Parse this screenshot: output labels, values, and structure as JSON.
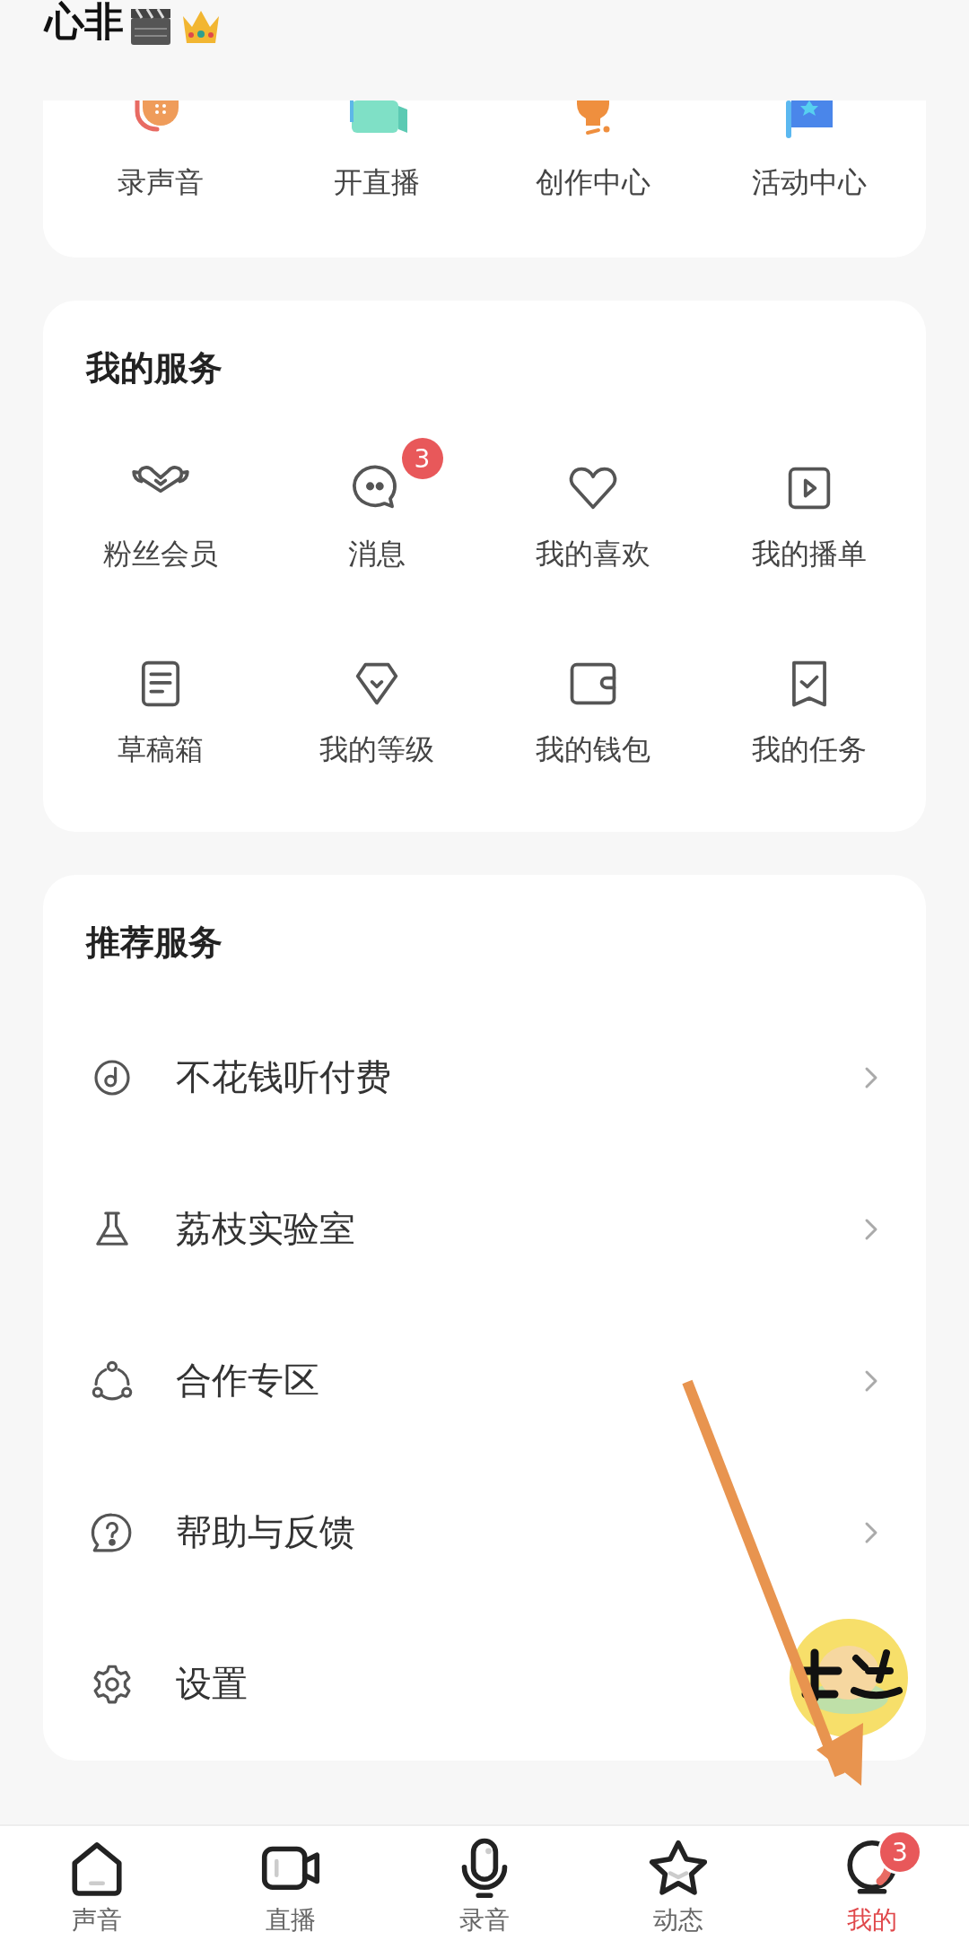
{
  "header": {
    "title": "心非"
  },
  "shortcuts": [
    {
      "label": "录声音",
      "kind": "mic"
    },
    {
      "label": "开直播",
      "kind": "live"
    },
    {
      "label": "创作中心",
      "kind": "bulb"
    },
    {
      "label": "活动中心",
      "kind": "flag"
    }
  ],
  "my_services": {
    "title": "我的服务",
    "items": [
      {
        "label": "粉丝会员",
        "kind": "wings"
      },
      {
        "label": "消息",
        "kind": "chat",
        "badge": "3"
      },
      {
        "label": "我的喜欢",
        "kind": "heart"
      },
      {
        "label": "我的播单",
        "kind": "play"
      },
      {
        "label": "草稿箱",
        "kind": "doc"
      },
      {
        "label": "我的等级",
        "kind": "gem"
      },
      {
        "label": "我的钱包",
        "kind": "wallet"
      },
      {
        "label": "我的任务",
        "kind": "task"
      }
    ]
  },
  "recommended": {
    "title": "推荐服务",
    "items": [
      {
        "label": "不花钱听付费",
        "kind": "disc",
        "chevron": true
      },
      {
        "label": "荔枝实验室",
        "kind": "flask",
        "chevron": true
      },
      {
        "label": "合作专区",
        "kind": "nodes",
        "chevron": true
      },
      {
        "label": "帮助与反馈",
        "kind": "help",
        "chevron": true
      },
      {
        "label": "设置",
        "kind": "gear",
        "chevron": false
      }
    ]
  },
  "tab_bar": [
    {
      "label": "声音",
      "kind": "home",
      "selected": false
    },
    {
      "label": "直播",
      "kind": "video",
      "selected": false
    },
    {
      "label": "录音",
      "kind": "mic",
      "selected": false
    },
    {
      "label": "动态",
      "kind": "star",
      "selected": false
    },
    {
      "label": "我的",
      "kind": "avatar",
      "selected": true,
      "badge": "3"
    }
  ]
}
